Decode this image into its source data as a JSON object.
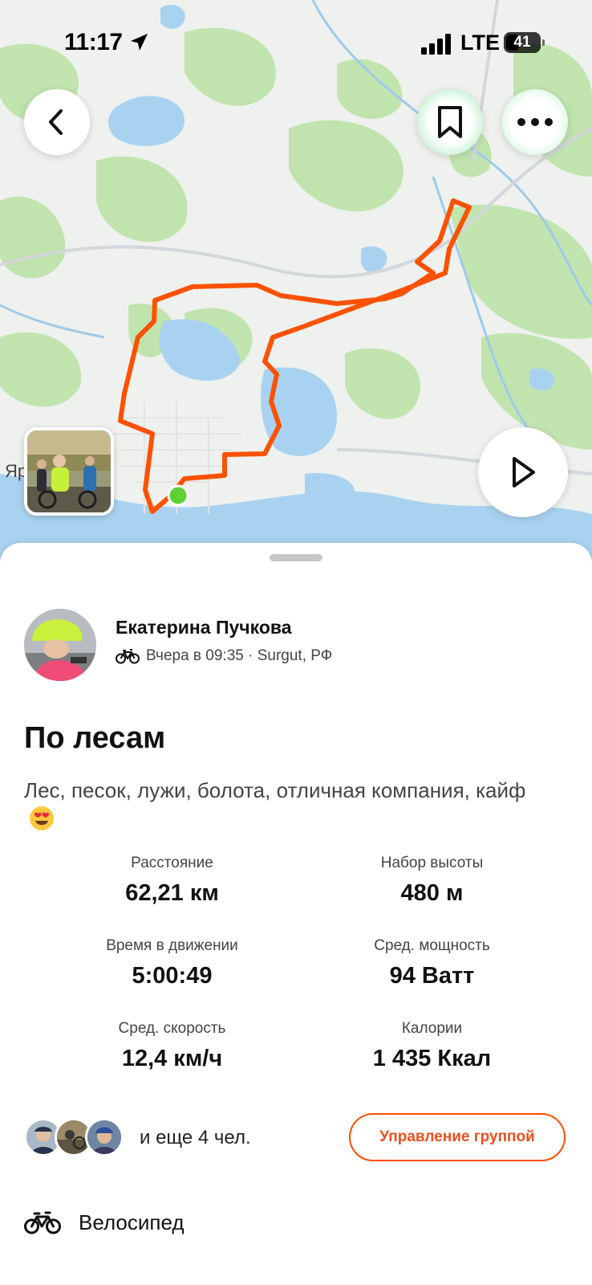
{
  "status_bar": {
    "time": "11:17",
    "network": "LTE",
    "battery": "41"
  },
  "map": {
    "place_label": "Яр",
    "route_color": "#fc5200",
    "start_marker_color": "#5cd034",
    "water_color": "#a9d2f0",
    "forest_color": "#b9e0a6",
    "icons": {
      "back": "chevron-left-icon",
      "bookmark": "bookmark-icon",
      "more": "more-horizontal-icon",
      "play": "play-icon"
    }
  },
  "athlete": {
    "name": "Екатерина Пучкова",
    "meta": "Вчера в 09:35 · Surgut, РФ"
  },
  "activity": {
    "title": "По лесам",
    "description": "Лес, песок, лужи, болота, отличная компания, кайф"
  },
  "stats": {
    "distance": {
      "label": "Расстояние",
      "value": "62,21 км"
    },
    "elevation": {
      "label": "Набор высоты",
      "value": "480 м"
    },
    "moving_time": {
      "label": "Время в движении",
      "value": "5:00:49"
    },
    "avg_power": {
      "label": "Сред. мощность",
      "value": "94 Ватт"
    },
    "avg_speed": {
      "label": "Сред. скорость",
      "value": "12,4 км/ч"
    },
    "calories": {
      "label": "Калории",
      "value": "1 435 Ккал"
    }
  },
  "group": {
    "others_text": "и еще 4 чел.",
    "manage_button": "Управление группой"
  },
  "sport": {
    "label": "Велосипед"
  },
  "colors": {
    "accent": "#fc4c02"
  }
}
